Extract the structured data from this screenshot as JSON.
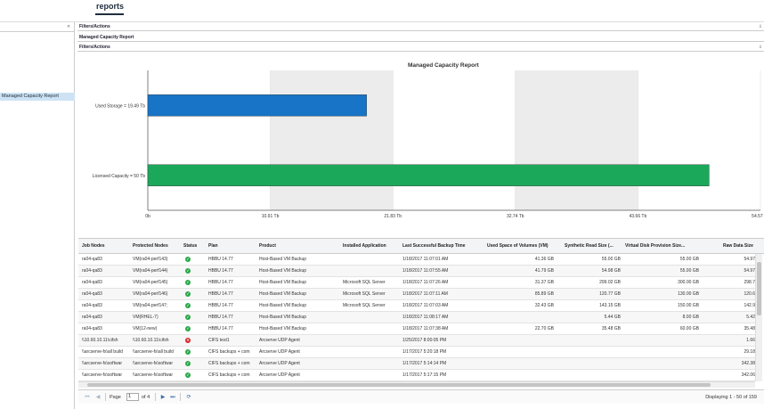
{
  "page": {
    "title": "reports"
  },
  "sidebar": {
    "collapse_icon": "«",
    "items": [
      {
        "label": "Managed Capacity Report"
      }
    ]
  },
  "panels": {
    "filters_top": "Filters/Actions",
    "report_name": "Managed Capacity Report",
    "filters_inner": "Filters/Actions",
    "collapse_glyph": "⇓"
  },
  "chart_data": {
    "type": "bar",
    "orientation": "horizontal",
    "title": "Managed Capacity Report",
    "categories": [
      "Used Storage = 19.49 Tb",
      "Licensed Capacity = 50 Tb"
    ],
    "values": [
      19.49,
      50
    ],
    "colors": [
      "#1774c6",
      "#1ca85a"
    ],
    "xlim": [
      0,
      54.57
    ],
    "xticks": [
      0,
      10.91,
      21.83,
      32.74,
      43.66,
      54.57
    ],
    "xtick_labels": [
      "0b",
      "10.91 Tb",
      "21.83 Tb",
      "32.74 Tb",
      "43.66 Tb",
      "54.57 Tb"
    ],
    "xlabel": "",
    "ylabel": "",
    "grid": "alternating vertical bands"
  },
  "table": {
    "columns": [
      "Job Nodes",
      "Protected Nodes",
      "Status",
      "Plan",
      "Product",
      "Installed Application",
      "Last Successful Backup Time",
      "Used Space of Volumes (VM)",
      "Synthetic Read Size (...",
      "Virtual Disk Provision Size...",
      "Raw Data Size"
    ],
    "rows": [
      [
        "ra04-qa83",
        "VM(ra04-perf143)",
        "ok",
        "HBBU 14.77",
        "Host-Based VM Backup",
        "",
        "1/18/2017 11:07:01 AM",
        "41.36 GB",
        "55.00 GB",
        "55.00 GB",
        "54.97"
      ],
      [
        "ra04-qa83",
        "VM(ra04-perf144)",
        "ok",
        "HBBU 14.77",
        "Host-Based VM Backup",
        "",
        "1/18/2017 11:07:55 AM",
        "41.79 GB",
        "54.98 GB",
        "55.00 GB",
        "54.97"
      ],
      [
        "ra04-qa83",
        "VM(ra04-perf145)",
        "ok",
        "HBBU 14.77",
        "Host-Based VM Backup",
        "Microsoft SQL Server",
        "1/18/2017 11:07:26 AM",
        "31.37 GB",
        "299.02 GB",
        "300.00 GB",
        "298.7"
      ],
      [
        "ra04-qa83",
        "VM(ra04-perf146)",
        "ok",
        "HBBU 14.77",
        "Host-Based VM Backup",
        "Microsoft SQL Server",
        "1/18/2017 11:07:11 AM",
        "85.89 GB",
        "120.77 GB",
        "130.00 GB",
        "120.6"
      ],
      [
        "ra04-qa83",
        "VM(ra04-perf147;",
        "ok",
        "HBBU 14.77",
        "Host-Based VM Backup",
        "Microsoft SQL Server",
        "1/18/2017 11:07:03 AM",
        "32.43 GB",
        "143.15 GB",
        "150.00 GB",
        "142.9"
      ],
      [
        "ra04-qa83",
        "VM(RHEL-7)",
        "ok",
        "HBBU 14.77",
        "Host-Based VM Backup",
        "",
        "1/18/2017 11:08:17 AM",
        "",
        "5.44 GB",
        "8.00 GB",
        "5.42"
      ],
      [
        "ra04-qa83",
        "VM(12-new)",
        "ok",
        "HBBU 14.77",
        "Host-Based VM Backup",
        "",
        "1/18/2017 11:07:38 AM",
        "22.70 GB",
        "35.48 GB",
        "60.00 GB",
        "35.48"
      ],
      [
        "\\\\10.60.10.11\\cifsh",
        "\\\\10.60.10.11\\cifsh",
        "err",
        "CIFS test1",
        "Arcserve UDP Agent",
        "",
        "1/25/2017 8:00:05 PM",
        "",
        "",
        "",
        "1.66"
      ],
      [
        "\\\\arcserve-fs\\all build",
        "\\\\arcserve-fs\\all build",
        "ok",
        "CIFS backups + com",
        "Arcserve UDP Agent",
        "",
        "1/17/2017 5:20:18 PM",
        "",
        "",
        "",
        "29.18"
      ],
      [
        "\\\\arcserve-fs\\softwar",
        "\\\\arcserve-fs\\softwar",
        "ok",
        "CIFS backups + com",
        "Arcserve UDP Agent",
        "",
        "1/17/2017 5:14:14 PM",
        "",
        "",
        "",
        "342.38"
      ],
      [
        "\\\\arcserve-fs\\softwar",
        "\\\\arcserve-fs\\softwar",
        "ok",
        "CIFS backups + com",
        "Arcserve UDP Agent",
        "",
        "1/17/2017 5:17:15 PM",
        "",
        "",
        "",
        "342.06"
      ]
    ]
  },
  "pager": {
    "first_icon": "⏮",
    "prev_icon": "◀",
    "next_icon": "▶",
    "last_icon": "⏭",
    "refresh_icon": "⟳",
    "page_label": "Page",
    "page_value": "1",
    "of_label": "of 4",
    "display_text": "Displaying 1 - 50 of 159"
  }
}
